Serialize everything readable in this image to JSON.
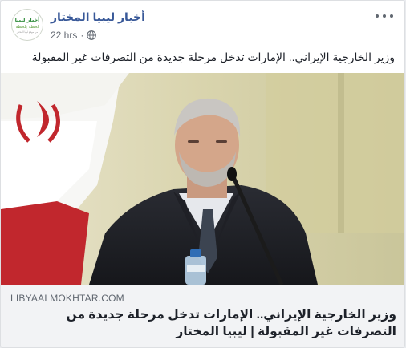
{
  "post": {
    "page_name": "أخبار ليبيا المختار",
    "timestamp": "22 hrs",
    "privacy_separator": "·",
    "privacy_icon": "globe-icon",
    "more_icon": "more-options-icon",
    "text": "وزير الخارجية الإيراني.. الإمارات تدخل مرحلة جديدة من التصرفات غير المقبولة"
  },
  "avatar": {
    "logo_line1": "أخبار ليبيا",
    "logo_line2": "لحظة بلحظة",
    "logo_line3": "من موقع ليبيا المختار",
    "accent": "#2e8b3a"
  },
  "link_preview": {
    "domain": "LIBYAALMOKHTAR.COM",
    "title": "وزير الخارجية الإيراني.. الإمارات تدخل مرحلة جديدة من التصرفات غير المقبولة | ليبيا المختار"
  },
  "colors": {
    "page_name": "#385898",
    "meta": "#616770",
    "card_bg": "#f2f3f5",
    "photo_bg": "#d9d5b2",
    "flag_red": "#c1272d"
  }
}
